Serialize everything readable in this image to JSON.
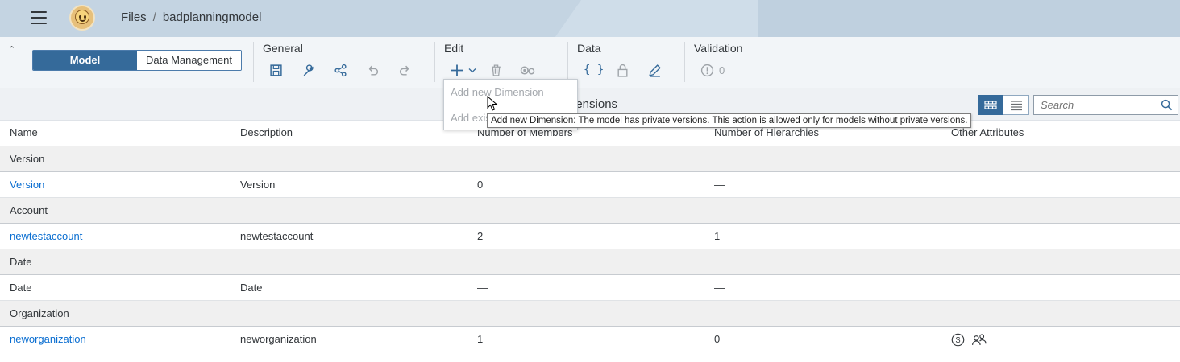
{
  "shell": {
    "breadcrumb": [
      "Files",
      "badplanningmodel"
    ],
    "separator": "/"
  },
  "toolbar": {
    "view_toggle": {
      "model": "Model",
      "data_management": "Data Management",
      "active": "Model"
    },
    "groups": {
      "general": "General",
      "edit": "Edit",
      "data": "Data",
      "validation": "Validation"
    },
    "validation_count": "0"
  },
  "menu": {
    "items": [
      "Add new Dimension",
      "Add existing Dimension"
    ]
  },
  "tooltip": "Add new Dimension: The model has private versions. This action is allowed only for models without private versions.",
  "subheader": {
    "title": "nensions"
  },
  "search": {
    "placeholder": "Search"
  },
  "table": {
    "columns": [
      "Name",
      "Description",
      "Number of Members",
      "Number of Hierarchies",
      "Other Attributes"
    ],
    "groups": [
      {
        "label": "Version",
        "rows": [
          {
            "name": "Version",
            "description": "Version",
            "members": "0",
            "hierarchies": "—",
            "link": true
          }
        ]
      },
      {
        "label": "Account",
        "rows": [
          {
            "name": "newtestaccount",
            "description": "newtestaccount",
            "members": "2",
            "hierarchies": "1",
            "link": true
          }
        ]
      },
      {
        "label": "Date",
        "rows": [
          {
            "name": "Date",
            "description": "Date",
            "members": "—",
            "hierarchies": "—",
            "link": false
          }
        ]
      },
      {
        "label": "Organization",
        "rows": [
          {
            "name": "neworganization",
            "description": "neworganization",
            "members": "1",
            "hierarchies": "0",
            "link": true,
            "attributes": [
              "currency-icon",
              "responsible-users-icon"
            ]
          }
        ]
      }
    ]
  },
  "colors": {
    "shell": "#c4d4e2",
    "accent": "#356a9a",
    "link": "#0a6ed1"
  }
}
